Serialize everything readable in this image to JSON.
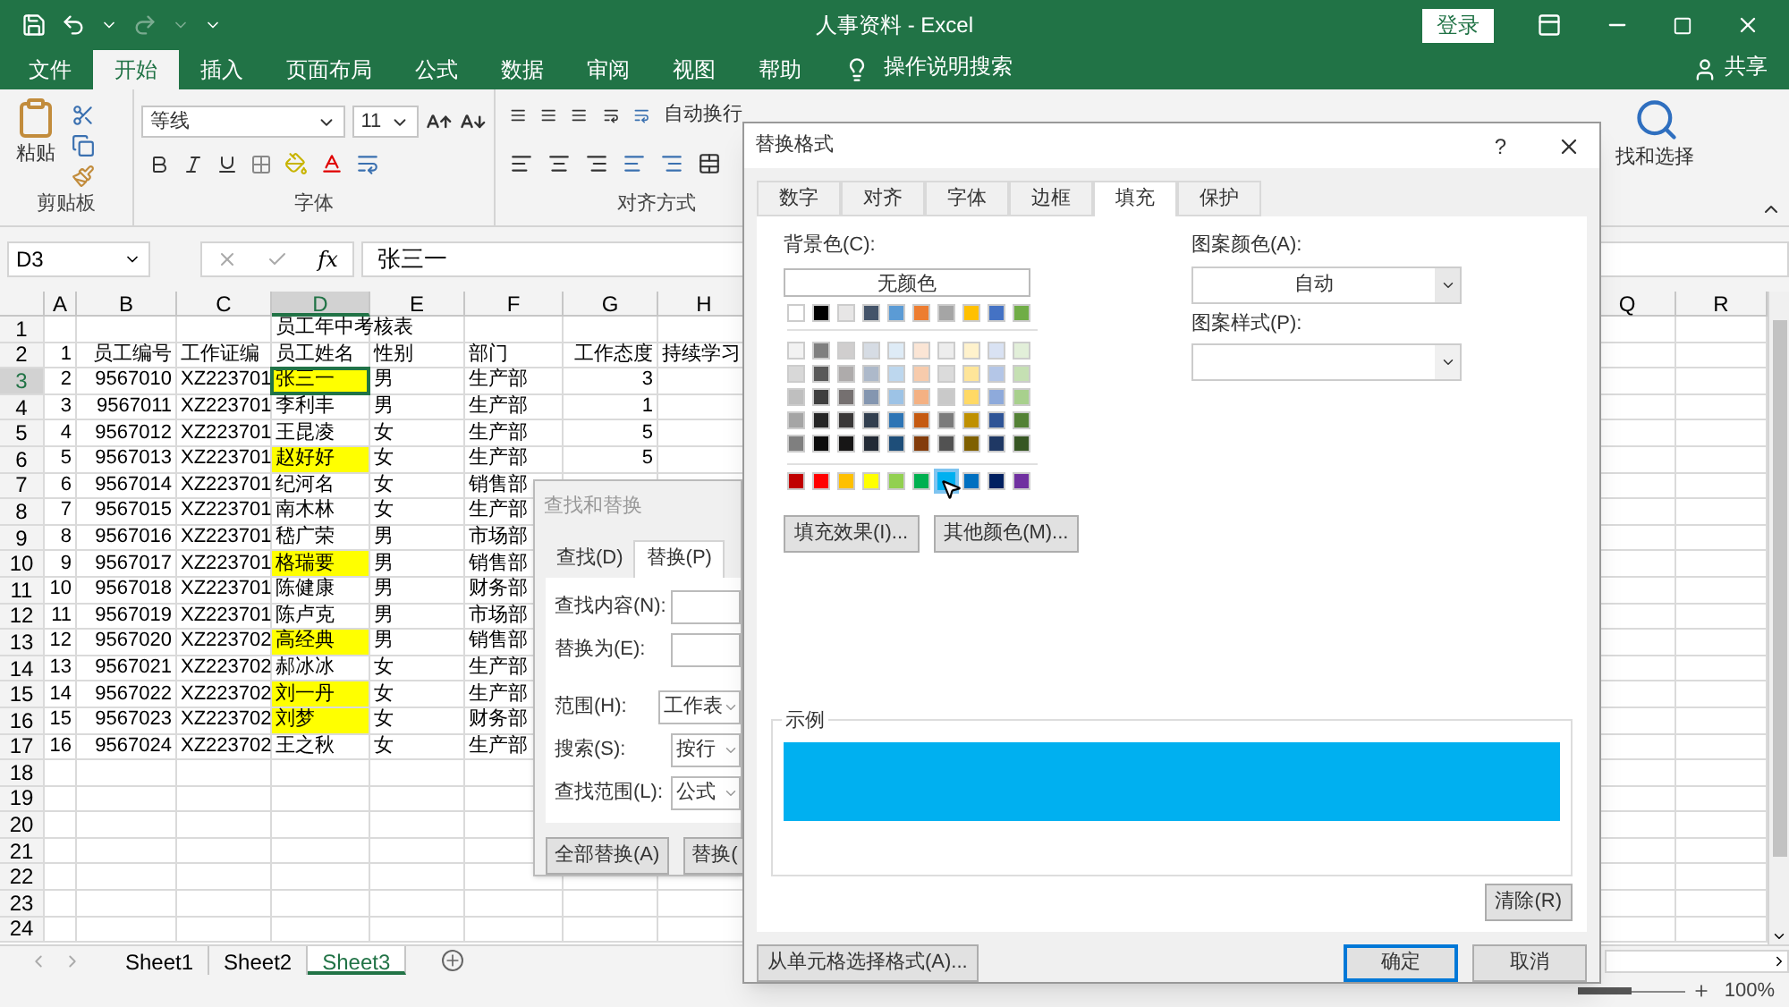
{
  "title_bar": {
    "title": "人事资料 - Excel",
    "sign_in": "登录"
  },
  "ribbon_tabs": [
    {
      "label": "文件",
      "selected": false
    },
    {
      "label": "开始",
      "selected": true
    },
    {
      "label": "插入",
      "selected": false
    },
    {
      "label": "页面布局",
      "selected": false
    },
    {
      "label": "公式",
      "selected": false
    },
    {
      "label": "数据",
      "selected": false
    },
    {
      "label": "审阅",
      "selected": false
    },
    {
      "label": "视图",
      "selected": false
    },
    {
      "label": "帮助",
      "selected": false
    }
  ],
  "tell_me": "操作说明搜索",
  "share": "共享",
  "ribbon": {
    "paste": "粘贴",
    "clipboard_group": "剪贴板",
    "font_name": "等线",
    "font_size": "11",
    "font_group": "字体",
    "wrap_text": "自动换行",
    "alignment_group": "对齐方式",
    "find_select": "找和选择"
  },
  "formula_bar": {
    "name_box": "D3",
    "fx": "fx",
    "value": "张三一"
  },
  "sheet": {
    "columns": [
      {
        "label": "A",
        "selected": false
      },
      {
        "label": "B",
        "selected": false
      },
      {
        "label": "C",
        "selected": false
      },
      {
        "label": "D",
        "selected": true
      },
      {
        "label": "E",
        "selected": false
      },
      {
        "label": "F",
        "selected": false
      },
      {
        "label": "G",
        "selected": false
      },
      {
        "label": "H",
        "selected": false
      }
    ],
    "tail_columns": [
      "Q",
      "R"
    ],
    "rows": [
      {
        "number": "1",
        "highlighted": false,
        "selected": false,
        "cells": {
          "d": "员工年中考核表"
        }
      },
      {
        "number": "2",
        "highlighted": false,
        "selected": false,
        "cells": {
          "a": "1",
          "b": "员工编号",
          "c": "工作证编",
          "d": "员工姓名",
          "e": "性别",
          "f": "部门",
          "g": "工作态度",
          "h": "持续学习"
        }
      },
      {
        "number": "3",
        "highlighted": true,
        "selected": true,
        "cells": {
          "a": "2",
          "b": "9567010",
          "c": "XZ223701",
          "d": "张三一",
          "e": "男",
          "f": "生产部",
          "g": "3"
        }
      },
      {
        "number": "4",
        "highlighted": false,
        "selected": false,
        "cells": {
          "a": "3",
          "b": "9567011",
          "c": "XZ223701",
          "d": "李利丰",
          "e": "男",
          "f": "生产部",
          "g": "1"
        }
      },
      {
        "number": "5",
        "highlighted": false,
        "selected": false,
        "cells": {
          "a": "4",
          "b": "9567012",
          "c": "XZ223701",
          "d": "王昆凌",
          "e": "女",
          "f": "生产部",
          "g": "5"
        }
      },
      {
        "number": "6",
        "highlighted": true,
        "selected": false,
        "cells": {
          "a": "5",
          "b": "9567013",
          "c": "XZ223701",
          "d": "赵好好",
          "e": "女",
          "f": "生产部",
          "g": "5"
        }
      },
      {
        "number": "7",
        "highlighted": false,
        "selected": false,
        "cells": {
          "a": "6",
          "b": "9567014",
          "c": "XZ223701",
          "d": "纪河名",
          "e": "女",
          "f": "销售部"
        }
      },
      {
        "number": "8",
        "highlighted": false,
        "selected": false,
        "cells": {
          "a": "7",
          "b": "9567015",
          "c": "XZ223701",
          "d": "南木林",
          "e": "女",
          "f": "生产部"
        }
      },
      {
        "number": "9",
        "highlighted": false,
        "selected": false,
        "cells": {
          "a": "8",
          "b": "9567016",
          "c": "XZ223701",
          "d": "嵇广荣",
          "e": "男",
          "f": "市场部"
        }
      },
      {
        "number": "10",
        "highlighted": true,
        "selected": false,
        "cells": {
          "a": "9",
          "b": "9567017",
          "c": "XZ223701",
          "d": "格瑞要",
          "e": "男",
          "f": "销售部"
        }
      },
      {
        "number": "11",
        "highlighted": false,
        "selected": false,
        "cells": {
          "a": "10",
          "b": "9567018",
          "c": "XZ223701",
          "d": "陈健康",
          "e": "男",
          "f": "财务部"
        }
      },
      {
        "number": "12",
        "highlighted": false,
        "selected": false,
        "cells": {
          "a": "11",
          "b": "9567019",
          "c": "XZ223701",
          "d": "陈卢克",
          "e": "男",
          "f": "市场部"
        }
      },
      {
        "number": "13",
        "highlighted": true,
        "selected": false,
        "cells": {
          "a": "12",
          "b": "9567020",
          "c": "XZ223702",
          "d": "高经典",
          "e": "男",
          "f": "销售部"
        }
      },
      {
        "number": "14",
        "highlighted": false,
        "selected": false,
        "cells": {
          "a": "13",
          "b": "9567021",
          "c": "XZ223702",
          "d": "郝冰冰",
          "e": "女",
          "f": "生产部"
        }
      },
      {
        "number": "15",
        "highlighted": true,
        "selected": false,
        "cells": {
          "a": "14",
          "b": "9567022",
          "c": "XZ223702",
          "d": "刘一丹",
          "e": "女",
          "f": "生产部"
        }
      },
      {
        "number": "16",
        "highlighted": true,
        "selected": false,
        "cells": {
          "a": "15",
          "b": "9567023",
          "c": "XZ223702",
          "d": "刘梦",
          "e": "女",
          "f": "财务部"
        }
      },
      {
        "number": "17",
        "highlighted": false,
        "selected": false,
        "cells": {
          "a": "16",
          "b": "9567024",
          "c": "XZ223702",
          "d": "王之秋",
          "e": "女",
          "f": "生产部"
        }
      },
      {
        "number": "18",
        "highlighted": false,
        "selected": false,
        "cells": {}
      },
      {
        "number": "19",
        "highlighted": false,
        "selected": false,
        "cells": {}
      },
      {
        "number": "20",
        "highlighted": false,
        "selected": false,
        "cells": {}
      },
      {
        "number": "21",
        "highlighted": false,
        "selected": false,
        "cells": {}
      },
      {
        "number": "22",
        "highlighted": false,
        "selected": false,
        "cells": {}
      },
      {
        "number": "23",
        "highlighted": false,
        "selected": false,
        "cells": {}
      },
      {
        "number": "24",
        "highlighted": false,
        "selected": false,
        "cells": {}
      }
    ]
  },
  "sheet_tabs": [
    {
      "label": "Sheet1",
      "selected": false
    },
    {
      "label": "Sheet2",
      "selected": false
    },
    {
      "label": "Sheet3",
      "selected": true
    }
  ],
  "status_bar": {
    "zoom": "100%",
    "zoom_slider": {
      "level": 0.5
    }
  },
  "find_dialog": {
    "title": "查找和替换",
    "tabs": [
      {
        "label": "查找(D)",
        "selected": false
      },
      {
        "label": "替换(P)",
        "selected": true
      }
    ],
    "fields": [
      {
        "kind": "text",
        "label": "查找内容(N):"
      },
      {
        "kind": "text",
        "label": "替换为(E):"
      },
      {
        "kind": "select",
        "label": "范围(H):",
        "value": "工作表"
      },
      {
        "kind": "select",
        "label": "搜索(S):",
        "value": "按行"
      },
      {
        "kind": "select",
        "label": "查找范围(L):",
        "value": "公式"
      }
    ],
    "buttons": [
      "全部替换(A)",
      "替换("
    ]
  },
  "format_dialog": {
    "title": "替换格式",
    "help": "?",
    "tabs": [
      {
        "label": "数字",
        "selected": false
      },
      {
        "label": "对齐",
        "selected": false
      },
      {
        "label": "字体",
        "selected": false
      },
      {
        "label": "边框",
        "selected": false
      },
      {
        "label": "填充",
        "selected": true
      },
      {
        "label": "保护",
        "selected": false
      }
    ],
    "background_label": "背景色(C):",
    "no_color": "无颜色",
    "swatch_rows": [
      {
        "kind": "theme",
        "swatches": [
          {
            "color": "#ffffff",
            "selected": false
          },
          {
            "color": "#000000",
            "selected": false
          },
          {
            "color": "#e7e6e6",
            "selected": false
          },
          {
            "color": "#44546a",
            "selected": false
          },
          {
            "color": "#5b9bd5",
            "selected": false
          },
          {
            "color": "#ed7d31",
            "selected": false
          },
          {
            "color": "#a5a5a5",
            "selected": false
          },
          {
            "color": "#ffc000",
            "selected": false
          },
          {
            "color": "#4472c4",
            "selected": false
          },
          {
            "color": "#70ad47",
            "selected": false
          }
        ]
      },
      {
        "kind": "tint",
        "swatches": [
          {
            "color": "#f2f2f2",
            "selected": false
          },
          {
            "color": "#7f7f7f",
            "selected": false
          },
          {
            "color": "#d0cece",
            "selected": false
          },
          {
            "color": "#d6dce4",
            "selected": false
          },
          {
            "color": "#deebf6",
            "selected": false
          },
          {
            "color": "#fbe5d5",
            "selected": false
          },
          {
            "color": "#ededed",
            "selected": false
          },
          {
            "color": "#fff2cc",
            "selected": false
          },
          {
            "color": "#d9e2f3",
            "selected": false
          },
          {
            "color": "#e2efd9",
            "selected": false
          }
        ]
      },
      {
        "kind": "tint",
        "swatches": [
          {
            "color": "#d8d8d8",
            "selected": false
          },
          {
            "color": "#595959",
            "selected": false
          },
          {
            "color": "#aeabab",
            "selected": false
          },
          {
            "color": "#adb9ca",
            "selected": false
          },
          {
            "color": "#bdd7ee",
            "selected": false
          },
          {
            "color": "#f7cbac",
            "selected": false
          },
          {
            "color": "#dbdbdb",
            "selected": false
          },
          {
            "color": "#fee599",
            "selected": false
          },
          {
            "color": "#b4c6e7",
            "selected": false
          },
          {
            "color": "#c5e0b3",
            "selected": false
          }
        ]
      },
      {
        "kind": "tint",
        "swatches": [
          {
            "color": "#bfbfbf",
            "selected": false
          },
          {
            "color": "#3f3f3f",
            "selected": false
          },
          {
            "color": "#757070",
            "selected": false
          },
          {
            "color": "#8496b0",
            "selected": false
          },
          {
            "color": "#9dc3e6",
            "selected": false
          },
          {
            "color": "#f4b183",
            "selected": false
          },
          {
            "color": "#c9c9c9",
            "selected": false
          },
          {
            "color": "#ffd965",
            "selected": false
          },
          {
            "color": "#8eaadb",
            "selected": false
          },
          {
            "color": "#a8d08d",
            "selected": false
          }
        ]
      },
      {
        "kind": "tint",
        "swatches": [
          {
            "color": "#a5a5a5",
            "selected": false
          },
          {
            "color": "#262626",
            "selected": false
          },
          {
            "color": "#3a3838",
            "selected": false
          },
          {
            "color": "#323f4f",
            "selected": false
          },
          {
            "color": "#2e75b5",
            "selected": false
          },
          {
            "color": "#c55a11",
            "selected": false
          },
          {
            "color": "#7b7b7b",
            "selected": false
          },
          {
            "color": "#bf9000",
            "selected": false
          },
          {
            "color": "#2f5496",
            "selected": false
          },
          {
            "color": "#538135",
            "selected": false
          }
        ]
      },
      {
        "kind": "tint",
        "swatches": [
          {
            "color": "#7f7f7f",
            "selected": false
          },
          {
            "color": "#0c0c0c",
            "selected": false
          },
          {
            "color": "#171616",
            "selected": false
          },
          {
            "color": "#222a35",
            "selected": false
          },
          {
            "color": "#1e4e79",
            "selected": false
          },
          {
            "color": "#833c0b",
            "selected": false
          },
          {
            "color": "#525252",
            "selected": false
          },
          {
            "color": "#7f6000",
            "selected": false
          },
          {
            "color": "#1f3864",
            "selected": false
          },
          {
            "color": "#375623",
            "selected": false
          }
        ]
      },
      {
        "kind": "standard",
        "swatches": [
          {
            "color": "#c00000",
            "selected": false
          },
          {
            "color": "#ff0000",
            "selected": false
          },
          {
            "color": "#ffc000",
            "selected": false
          },
          {
            "color": "#ffff00",
            "selected": false
          },
          {
            "color": "#92d050",
            "selected": false
          },
          {
            "color": "#00b050",
            "selected": false
          },
          {
            "color": "#00b0f0",
            "selected": true
          },
          {
            "color": "#0070c0",
            "selected": false
          },
          {
            "color": "#002060",
            "selected": false
          },
          {
            "color": "#7030a0",
            "selected": false
          }
        ]
      }
    ],
    "fill_effects": "填充效果(I)...",
    "more_colors": "其他颜色(M)...",
    "pattern_color_label": "图案颜色(A):",
    "pattern_color": "自动",
    "pattern_style_label": "图案样式(P):",
    "sample_label": "示例",
    "clear": "清除(R)",
    "pick_from_cell": "从单元格选择格式(A)...",
    "ok": "确定",
    "cancel": "取消"
  }
}
